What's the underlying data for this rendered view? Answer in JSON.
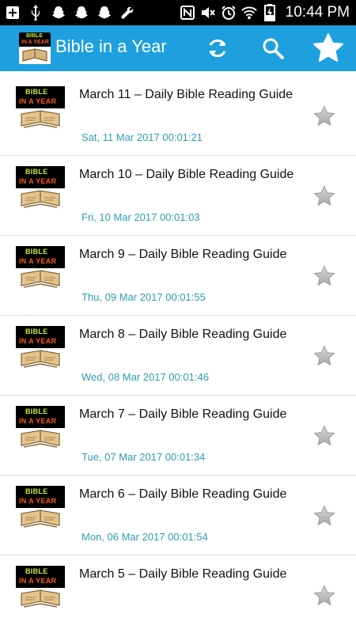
{
  "status_bar": {
    "time": "10:44 PM",
    "left_icons": [
      "plus-box-icon",
      "usb-icon",
      "snapchat-icon",
      "snapchat-icon",
      "snapchat-icon",
      "wrench-icon"
    ],
    "right_icons": [
      "nfc-icon",
      "mute-icon",
      "alarm-icon",
      "wifi-icon",
      "battery-charging-icon"
    ]
  },
  "action_bar": {
    "title": "Bible in a Year",
    "logo_line1": "BIBLE",
    "logo_line2": "IN A YEAR",
    "accent_color": "#1ea0de"
  },
  "thumbnail": {
    "line1": "BIBLE",
    "line2": "IN A YEAR"
  },
  "items": [
    {
      "title": "March 11 –  Daily Bible Reading Guide",
      "date": "Sat, 11 Mar 2017 00:01:21"
    },
    {
      "title": "March 10 –  Daily Bible Reading Guide",
      "date": "Fri, 10 Mar 2017 00:01:03"
    },
    {
      "title": "March 9 –  Daily Bible Reading Guide",
      "date": "Thu, 09 Mar 2017 00:01:55"
    },
    {
      "title": "March 8 –  Daily Bible Reading Guide",
      "date": "Wed, 08 Mar 2017 00:01:46"
    },
    {
      "title": "March 7 –  Daily Bible Reading Guide",
      "date": "Tue, 07 Mar 2017 00:01:34"
    },
    {
      "title": "March 6 –  Daily Bible Reading Guide",
      "date": "Mon, 06 Mar 2017 00:01:54"
    },
    {
      "title": "March 5 –  Daily Bible Reading Guide",
      "date": ""
    }
  ]
}
